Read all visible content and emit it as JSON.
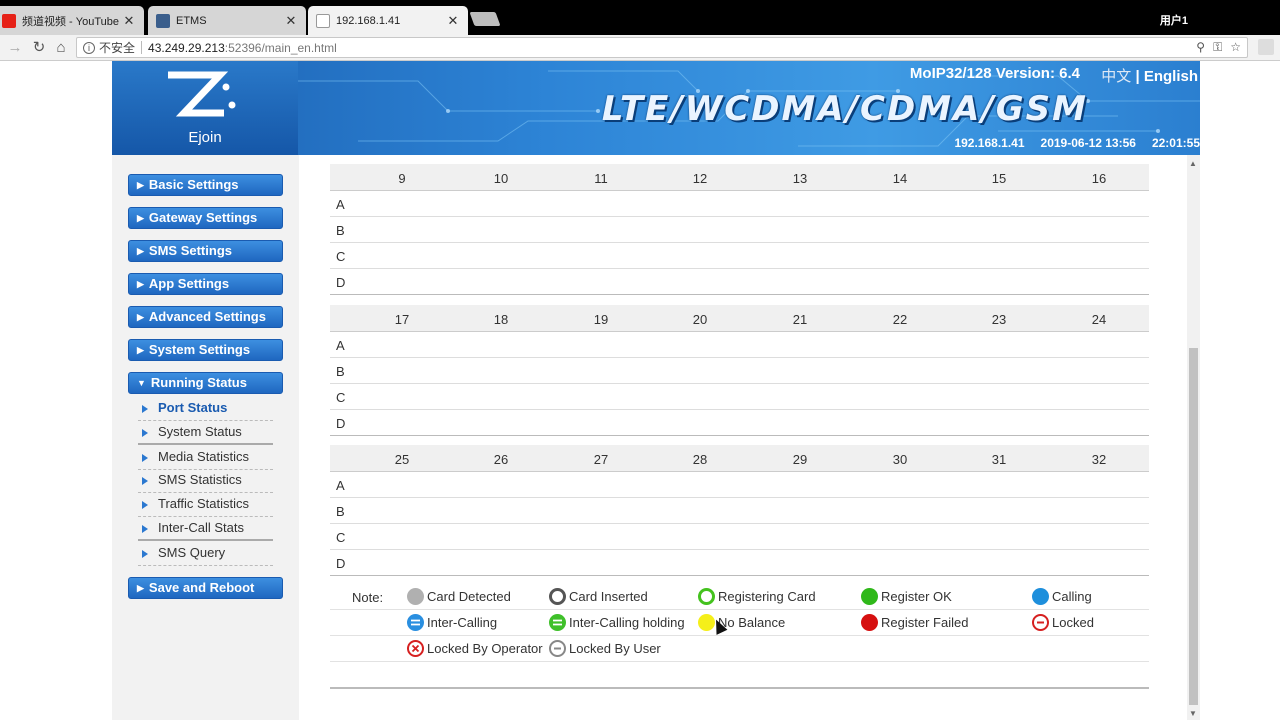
{
  "browser": {
    "tabs": [
      {
        "title": "频道视频 - YouTube St",
        "fav_color": "#e62117"
      },
      {
        "title": "ETMS",
        "fav_color": "#3a5e8c"
      },
      {
        "title": "192.168.1.41",
        "fav_color": "#ffffff"
      }
    ],
    "user_label": "用户1",
    "insecure_label": "不安全",
    "url_host": "43.249.29.213",
    "url_rest": ":52396/main_en.html"
  },
  "header": {
    "logo_text": "Ejoin",
    "version": "MoIP32/128 Version: 6.4",
    "lang_cn": "中文",
    "lang_sep": "|",
    "lang_en": "English",
    "title": "LTE/WCDMA/CDMA/GSM",
    "ip": "192.168.1.41",
    "date": "2019-06-12 13:56",
    "uptime": "22:01:55"
  },
  "sidebar": {
    "menus": [
      {
        "label": "Basic Settings"
      },
      {
        "label": "Gateway Settings"
      },
      {
        "label": "SMS Settings"
      },
      {
        "label": "App Settings"
      },
      {
        "label": "Advanced Settings"
      },
      {
        "label": "System Settings"
      },
      {
        "label": "Running Status"
      }
    ],
    "subitems": [
      {
        "label": "Port Status"
      },
      {
        "label": "System Status"
      },
      {
        "label": "Media Statistics"
      },
      {
        "label": "SMS Statistics"
      },
      {
        "label": "Traffic Statistics"
      },
      {
        "label": "Inter-Call Stats"
      },
      {
        "label": "SMS Query"
      }
    ],
    "save_label": "Save and Reboot"
  },
  "port_tables": [
    {
      "ports": [
        "9",
        "10",
        "11",
        "12",
        "13",
        "14",
        "15",
        "16"
      ],
      "rows": [
        "A",
        "B",
        "C",
        "D"
      ]
    },
    {
      "ports": [
        "17",
        "18",
        "19",
        "20",
        "21",
        "22",
        "23",
        "24"
      ],
      "rows": [
        "A",
        "B",
        "C",
        "D"
      ]
    },
    {
      "ports": [
        "25",
        "26",
        "27",
        "28",
        "29",
        "30",
        "31",
        "32"
      ],
      "rows": [
        "A",
        "B",
        "C",
        "D"
      ]
    }
  ],
  "legend": {
    "note": "Note:",
    "items": [
      {
        "label": "Card Detected",
        "color": "#b0b0b0"
      },
      {
        "label": "Card Inserted",
        "color": "#555555"
      },
      {
        "label": "Registering Card",
        "color": "#44c21e"
      },
      {
        "label": "Register OK",
        "color": "#2fb81a"
      },
      {
        "label": "Calling",
        "color": "#1e8fdc"
      },
      {
        "label": "Inter-Calling",
        "color": "#2a8fe0"
      },
      {
        "label": "Inter-Calling holding",
        "color": "#3fc02a"
      },
      {
        "label": "No Balance",
        "color": "#f5ef1a"
      },
      {
        "label": "Register Failed",
        "color": "#d61010"
      },
      {
        "label": "Locked",
        "color": "#d62020"
      },
      {
        "label": "Locked By Operator",
        "color": "#d62020"
      },
      {
        "label": "Locked By User",
        "color": "#888888"
      }
    ]
  }
}
